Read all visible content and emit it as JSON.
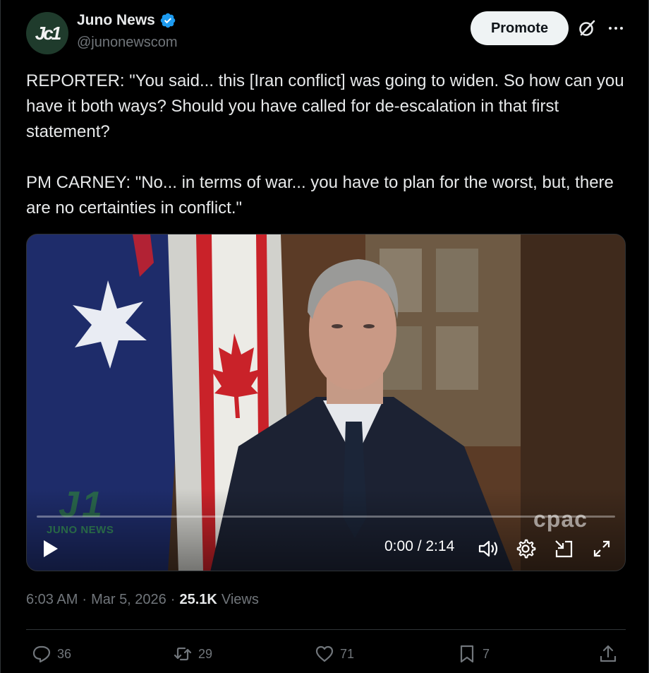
{
  "author": {
    "display_name": "Juno News",
    "handle": "@junonewscom",
    "avatar_text": "Jс1"
  },
  "header": {
    "promote_label": "Promote"
  },
  "post": {
    "text": "REPORTER: \"You said... this [Iran conflict] was going to widen. So how can you have it both ways? Should you have called for de-escalation in that first statement?\n\nPM CARNEY: \"No... in terms of war... you have to plan for the worst, but, there are no certainties in conflict.\""
  },
  "video": {
    "time_display": "0:00 / 2:14",
    "watermark_left": "JUNO NEWS",
    "watermark_right": "cpac",
    "progress": 0
  },
  "meta": {
    "time": "6:03 AM",
    "separator": "·",
    "date": "Mar 5, 2026",
    "views_count": "25.1K",
    "views_label": "Views"
  },
  "actions": {
    "replies": "36",
    "reposts": "29",
    "likes": "71",
    "bookmarks": "7"
  },
  "colors": {
    "background": "#000000",
    "text": "#e7e9ea",
    "muted": "#71767b",
    "verified": "#1d9bf0"
  }
}
